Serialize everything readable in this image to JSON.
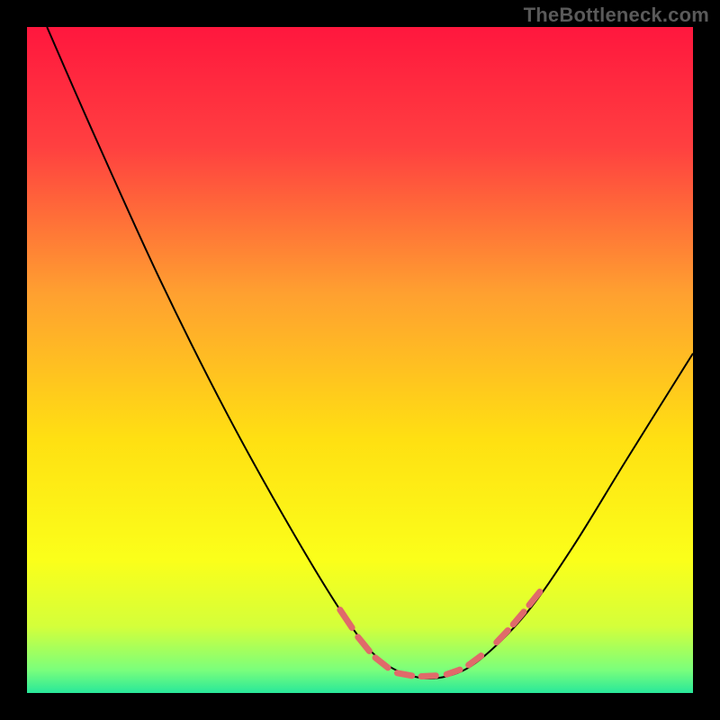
{
  "watermark": "TheBottleneck.com",
  "chart_data": {
    "type": "line",
    "title": "",
    "xlabel": "",
    "ylabel": "",
    "xlim": [
      0,
      100
    ],
    "ylim": [
      0,
      100
    ],
    "background_gradient": {
      "stops": [
        {
          "offset": 0.0,
          "color": "#ff173e"
        },
        {
          "offset": 0.18,
          "color": "#ff4040"
        },
        {
          "offset": 0.4,
          "color": "#ffa030"
        },
        {
          "offset": 0.62,
          "color": "#ffe012"
        },
        {
          "offset": 0.8,
          "color": "#fbff1a"
        },
        {
          "offset": 0.9,
          "color": "#d4ff3a"
        },
        {
          "offset": 0.965,
          "color": "#7bff7b"
        },
        {
          "offset": 1.0,
          "color": "#28e89a"
        }
      ]
    },
    "series": [
      {
        "name": "bottleneck-curve",
        "stroke": "#000000",
        "stroke_width": 2,
        "points": [
          {
            "x": 3,
            "y": 100
          },
          {
            "x": 10,
            "y": 84
          },
          {
            "x": 20,
            "y": 62
          },
          {
            "x": 30,
            "y": 42
          },
          {
            "x": 40,
            "y": 24
          },
          {
            "x": 48,
            "y": 11
          },
          {
            "x": 53,
            "y": 5
          },
          {
            "x": 58,
            "y": 2.5
          },
          {
            "x": 63,
            "y": 2.5
          },
          {
            "x": 68,
            "y": 5
          },
          {
            "x": 75,
            "y": 12
          },
          {
            "x": 82,
            "y": 22
          },
          {
            "x": 90,
            "y": 35
          },
          {
            "x": 100,
            "y": 51
          }
        ]
      }
    ],
    "markers": {
      "name": "highlight-dashes",
      "stroke": "#e06a6a",
      "stroke_width": 7,
      "segments": [
        {
          "x1": 47.0,
          "y1": 12.5,
          "x2": 48.8,
          "y2": 9.8
        },
        {
          "x1": 49.7,
          "y1": 8.4,
          "x2": 51.4,
          "y2": 6.3
        },
        {
          "x1": 52.3,
          "y1": 5.3,
          "x2": 54.2,
          "y2": 3.8
        },
        {
          "x1": 55.6,
          "y1": 3.0,
          "x2": 57.8,
          "y2": 2.6
        },
        {
          "x1": 59.2,
          "y1": 2.5,
          "x2": 61.4,
          "y2": 2.6
        },
        {
          "x1": 63.0,
          "y1": 2.8,
          "x2": 65.0,
          "y2": 3.5
        },
        {
          "x1": 66.3,
          "y1": 4.2,
          "x2": 68.2,
          "y2": 5.6
        },
        {
          "x1": 70.5,
          "y1": 7.6,
          "x2": 72.2,
          "y2": 9.4
        },
        {
          "x1": 73.0,
          "y1": 10.3,
          "x2": 74.6,
          "y2": 12.2
        },
        {
          "x1": 75.4,
          "y1": 13.2,
          "x2": 77.0,
          "y2": 15.2
        }
      ]
    }
  }
}
